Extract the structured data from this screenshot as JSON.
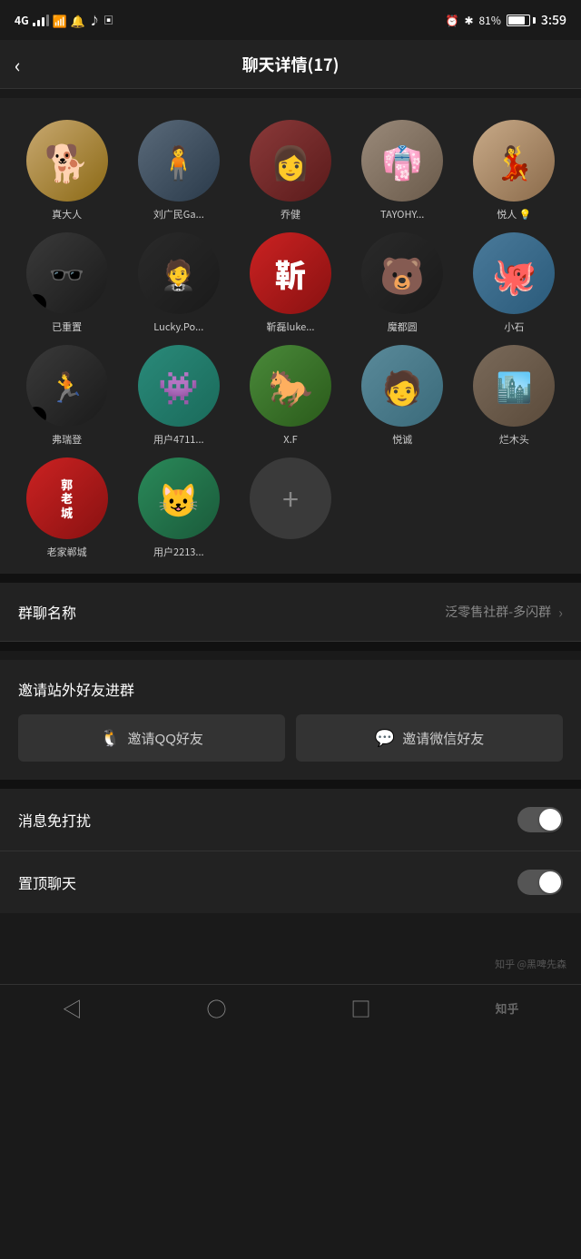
{
  "statusBar": {
    "network": "4G",
    "signalLevel": 3,
    "time": "3:59",
    "battery": "81%",
    "icons": [
      "bluetooth",
      "sound",
      "tiktok"
    ]
  },
  "header": {
    "title": "聊天详情(17)",
    "backLabel": "‹"
  },
  "members": [
    {
      "name": "真大人",
      "avatar_type": "dog",
      "avatar_emoji": "🐕"
    },
    {
      "name": "刘广民Ga...",
      "avatar_type": "liu",
      "avatar_text": "人"
    },
    {
      "name": "乔健",
      "avatar_type": "qiao",
      "avatar_text": "女"
    },
    {
      "name": "TAYOHY...",
      "avatar_type": "tay",
      "avatar_text": "👘"
    },
    {
      "name": "悦人 💡",
      "avatar_type": "yue",
      "avatar_text": "💃"
    },
    {
      "name": "已重置",
      "avatar_type": "reset",
      "avatar_text": "🕶️"
    },
    {
      "name": "Lucky.Po...",
      "avatar_type": "lucky",
      "avatar_text": "🤵"
    },
    {
      "name": "靳磊luke...",
      "avatar_type": "xin",
      "avatar_ch": "靳"
    },
    {
      "name": "魔都圆",
      "avatar_type": "mo",
      "avatar_emoji": "🐻"
    },
    {
      "name": "小石",
      "avatar_type": "shi",
      "avatar_emoji": "🐙"
    },
    {
      "name": "弗瑞登",
      "avatar_type": "fu",
      "avatar_text": "🏃"
    },
    {
      "name": "用户4711...",
      "avatar_type": "user47",
      "avatar_emoji": "👾"
    },
    {
      "name": "X.F",
      "avatar_type": "xf",
      "avatar_emoji": "🐴"
    },
    {
      "name": "悦诚",
      "avatar_type": "yuec",
      "avatar_text": "👤"
    },
    {
      "name": "烂木头",
      "avatar_type": "zai",
      "avatar_text": "🏙️"
    },
    {
      "name": "老家郸城",
      "avatar_type": "lao",
      "avatar_ch": "郭老城"
    },
    {
      "name": "用户2213...",
      "avatar_type": "user22",
      "avatar_emoji": "😺"
    }
  ],
  "addButton": {
    "label": "+"
  },
  "settings": {
    "groupNameLabel": "群聊名称",
    "groupNameValue": "泛零售社群-多闪群",
    "inviteTitle": "邀请站外好友进群",
    "inviteQQ": "邀请QQ好友",
    "inviteWechat": "邀请微信好友",
    "muteLabel": "消息免打扰",
    "pinLabel": "置顶聊天"
  },
  "navbar": {
    "back": "◁",
    "home": "○",
    "square": "□",
    "watermark": "知乎 @黑啤先森"
  }
}
